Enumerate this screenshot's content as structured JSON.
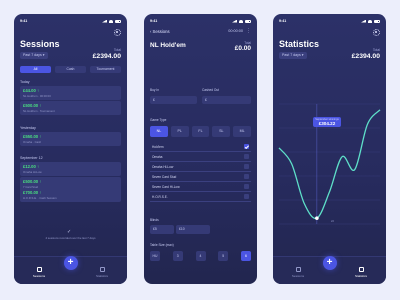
{
  "status_time": "9:41",
  "sessions": {
    "title": "Sessions",
    "period": "Past 7 days ▾",
    "total_label": "Total",
    "total_value": "£2394.00",
    "tabs": [
      "All",
      "Cash",
      "Tournament"
    ],
    "groups": [
      {
        "header": "Today",
        "items": [
          {
            "amount": "£44.00 ↑",
            "desc": "NL Hold'em · 00:00:00"
          },
          {
            "amount": "£500.00 ↑",
            "desc": "NL Hold'em · Tournament"
          }
        ]
      },
      {
        "header": "Yesterday",
        "items": [
          {
            "amount": "£550.00 ↑",
            "desc": "Omaha · Cash"
          }
        ]
      },
      {
        "header": "September 12",
        "items": [
          {
            "amount": "£12.00 ↑",
            "desc": "Omaha Hi-Low"
          },
          {
            "amount": "£500.00 ↑",
            "desc": "7 Card Stud"
          },
          {
            "amount": "£700.00 ↑",
            "desc": "H.O.R.S.E. · Cash Session"
          }
        ]
      }
    ],
    "note": "4 sessions recorded over the last 7 days",
    "nav_sessions": "Sessions",
    "nav_statistics": "Statistics"
  },
  "session_detail": {
    "back_label": "‹ Sessions",
    "timer": "00:00:00",
    "title": "NL Hold'em",
    "total_label": "Total",
    "total_value": "£0.00",
    "buyin_label": "Buy In",
    "cashout_label": "Cashed Out",
    "buyin_value": "£",
    "cashout_value": "£",
    "gametype_label": "Game Type",
    "gametypes": [
      "NL",
      "PL",
      "FL",
      "SL",
      "ML"
    ],
    "games": [
      "Hold'em",
      "Omaha",
      "Omaha Hi-Low",
      "Seven Card Stud",
      "Seven Card Hi-Low",
      "H.O.R.S.E."
    ],
    "blinds_label": "Blinds",
    "blind_small": "£5",
    "blind_big": "£10",
    "table_size_label": "Table Size (max)",
    "table_sizes": [
      "HU",
      "3",
      "4",
      "5",
      "6"
    ]
  },
  "statistics": {
    "title": "Statistics",
    "period": "Past 7 days ▾",
    "total_label": "Total",
    "total_value": "£2394.00",
    "tooltip_label": "September winnings",
    "tooltip_value": "£304.22",
    "x_label": "22",
    "nav_sessions": "Sessions",
    "nav_statistics": "Statistics"
  },
  "colors": {
    "accent": "#4b55e3",
    "positive": "#4ade80",
    "line": "#5ee0c9",
    "background": "#272b5e"
  },
  "chart_data": {
    "type": "line",
    "x": [
      0,
      1,
      2,
      3,
      4,
      5,
      6,
      7,
      8
    ],
    "values": [
      55,
      28,
      -40,
      -65,
      -20,
      40,
      18,
      95,
      120
    ],
    "title": "",
    "xlabel": "",
    "ylabel": ""
  }
}
